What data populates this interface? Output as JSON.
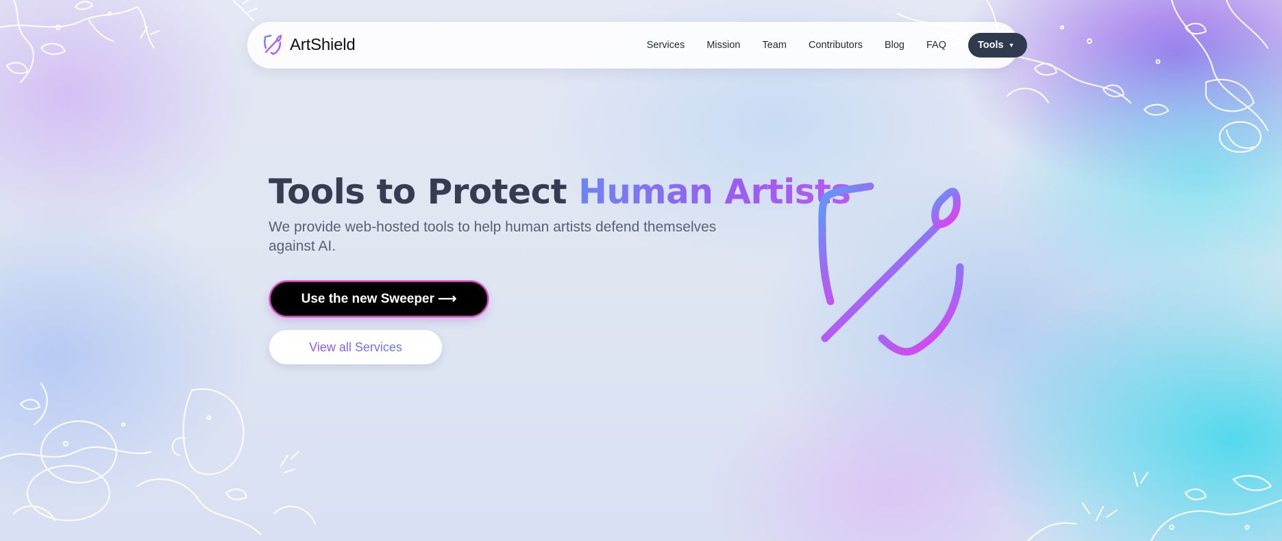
{
  "brand": {
    "name": "ArtShield",
    "icon": "shield-brush-icon"
  },
  "nav": {
    "links": [
      "Services",
      "Mission",
      "Team",
      "Contributors",
      "Blog",
      "FAQ"
    ],
    "tools_label": "Tools",
    "tools_icon": "caret-down-icon"
  },
  "hero": {
    "title_plain": "Tools to Protect",
    "title_accent": "Human Artists",
    "subtitle": "We provide web-hosted tools to help human artists defend themselves against AI.",
    "primary_cta": "Use the new Sweeper ⟶",
    "secondary_cta": "View all Services",
    "illustration_icon": "shield-brush-icon"
  },
  "colors": {
    "accent_blue": "#5b9cf6",
    "accent_purple": "#9b5cf0",
    "accent_magenta": "#e040f0",
    "dark_button": "#2f3a4f"
  }
}
